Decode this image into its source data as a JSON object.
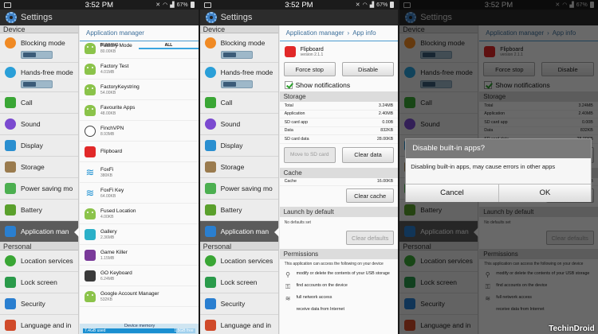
{
  "status": {
    "time": "3:52 PM",
    "battery": "67%"
  },
  "title": "Settings",
  "categories": {
    "device": "Device",
    "personal": "Personal"
  },
  "sidebar": {
    "blocking": "Blocking mode",
    "handsfree": "Hands-free mode",
    "call": "Call",
    "sound": "Sound",
    "display": "Display",
    "storage": "Storage",
    "powersaving": "Power saving mo",
    "battery": "Battery",
    "appmgr": "Application man",
    "location": "Location services",
    "lock": "Lock screen",
    "security": "Security",
    "language": "Language and in"
  },
  "p1": {
    "crumb": "Application manager",
    "tabs": [
      "RUNNING",
      "ALL"
    ],
    "apps": [
      {
        "name": "Factory Mode",
        "size": "80.00KB"
      },
      {
        "name": "Factory Test",
        "size": "4.01MB"
      },
      {
        "name": "FactoryKeystring",
        "size": "54.00KB"
      },
      {
        "name": "Favourite Apps",
        "size": "48.00KB"
      },
      {
        "name": "FinchVPN",
        "size": "8.93MB"
      },
      {
        "name": "Flipboard",
        "size": ""
      },
      {
        "name": "FoxFi",
        "size": "380KB"
      },
      {
        "name": "FoxFi Key",
        "size": "64.00KB"
      },
      {
        "name": "Fused Location",
        "size": "4.00KB"
      },
      {
        "name": "Gallery",
        "size": "2.36MB"
      },
      {
        "name": "Game Killer",
        "size": "1.15MB"
      },
      {
        "name": "GO Keyboard",
        "size": "6.24MB"
      },
      {
        "name": "Google Account Manager",
        "size": "532KB"
      }
    ],
    "memory": {
      "label": "Device memory",
      "used": "7.4GB used",
      "free": "1.5GB free",
      "used_fraction": 0.83
    }
  },
  "p2": {
    "crumb": [
      "Application manager",
      "App info"
    ],
    "app": {
      "name": "Flipboard",
      "version": "version 2.1.1"
    },
    "force_stop": "Force stop",
    "disable": "Disable",
    "show_notifications": "Show notifications",
    "storage_title": "Storage",
    "storage": [
      {
        "k": "Total",
        "v": "3.24MB"
      },
      {
        "k": "Application",
        "v": "2.40MB"
      },
      {
        "k": "SD card app",
        "v": "0.00B"
      },
      {
        "k": "Data",
        "v": "832KB"
      },
      {
        "k": "SD card data",
        "v": "28.00KB"
      }
    ],
    "move_sd": "Move to SD card",
    "clear_data": "Clear data",
    "cache_title": "Cache",
    "cache": {
      "k": "Cache",
      "v": "16.00KB"
    },
    "clear_cache": "Clear cache",
    "launch_title": "Launch by default",
    "no_defaults": "No defaults set",
    "clear_defaults": "Clear defaults",
    "perm_title": "Permissions",
    "perm_intro": "This application can access the following on your device",
    "perms": [
      "modify or delete the contents of your USB storage",
      "find accounts on the device",
      "full network access",
      "receive data from Internet"
    ]
  },
  "dialog": {
    "title": "Disable built-in apps?",
    "message": "Disabling built-in apps, may cause errors in other apps",
    "cancel": "Cancel",
    "ok": "OK"
  },
  "watermark": "TechinDroid",
  "colors": {
    "accent": "#3aa5e0",
    "flipboard": "#e12828",
    "dim": "#000000"
  }
}
